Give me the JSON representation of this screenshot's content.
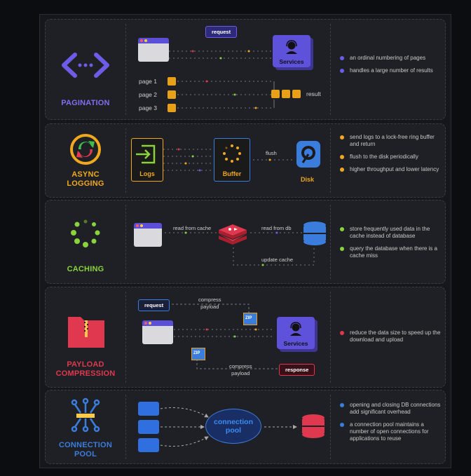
{
  "colors": {
    "pagination": "#6c5ce7",
    "async": "#f0a81e",
    "caching": "#8ad33c",
    "payload": "#e0384f",
    "pool": "#3b7ddd"
  },
  "pagination": {
    "title": "PAGINATION",
    "icon": "code-brackets-icon",
    "request": "request",
    "services": "Services",
    "pages": [
      "page 1",
      "page 2",
      "page 3"
    ],
    "result": "result",
    "bullets": [
      "an ordinal numbering of pages",
      "handles a large number of results"
    ]
  },
  "async_logging": {
    "title_line1": "ASYNC",
    "title_line2": "LOGGING",
    "icon": "refresh-cycle-icon",
    "logs": "Logs",
    "buffer": "Buffer",
    "flush": "flush",
    "disk": "Disk",
    "bullets": [
      "send logs to a lock-free ring buffer and return",
      "flush to the disk periodically",
      "higher throughput and lower latency"
    ]
  },
  "caching": {
    "title": "CACHING",
    "icon": "loading-dots-icon",
    "read_from_cache": "read from cache",
    "read_from_db": "read from db",
    "update_cache": "update cache",
    "bullets": [
      "store frequently used data in the cache instead of database",
      "query the database when there is a cache miss"
    ]
  },
  "payload": {
    "title_line1": "PAYLOAD",
    "title_line2": "COMPRESSION",
    "icon": "zip-folder-icon",
    "request": "request",
    "compress_payload_top_1": "compress",
    "compress_payload_top_2": "payload",
    "zip": "ZIP",
    "services": "Services",
    "compress_payload_bottom_1": "compress",
    "compress_payload_bottom_2": "payload",
    "response": "response",
    "bullets": [
      "reduce the data size to speed up the download and upload"
    ]
  },
  "pool": {
    "title_line1": "CONNECTION",
    "title_line2": "POOL",
    "icon": "network-hub-icon",
    "pool_line1": "connection",
    "pool_line2": "pool",
    "bullets": [
      "opening and closing DB connections add significant overhead",
      "a connection pool maintains a number of open connections for applications to reuse"
    ]
  }
}
